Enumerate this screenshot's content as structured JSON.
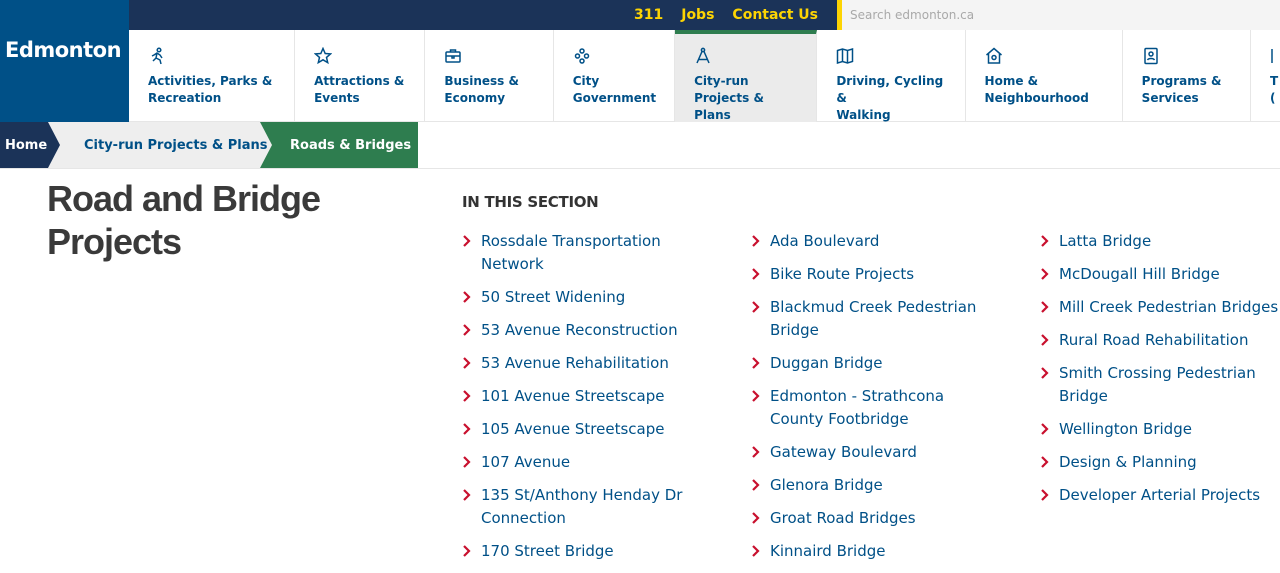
{
  "brand": {
    "logo_text": "Edmonton",
    "colors": {
      "primary_blue": "#005087",
      "navy": "#1b3358",
      "accent_yellow": "#fdd403",
      "green": "#2e7d4f",
      "chevron_red": "#c8102e"
    }
  },
  "utility": {
    "links": [
      "311",
      "Jobs",
      "Contact Us"
    ],
    "search_placeholder": "Search edmonton.ca"
  },
  "nav": {
    "items": [
      {
        "line1": "Activities, Parks &",
        "line2": "Recreation",
        "icon": "running-person-icon"
      },
      {
        "line1": "Attractions &",
        "line2": "Events",
        "icon": "star-icon"
      },
      {
        "line1": "Business &",
        "line2": "Economy",
        "icon": "briefcase-icon"
      },
      {
        "line1": "City",
        "line2": "Government",
        "icon": "people-group-icon"
      },
      {
        "line1": "City-run Projects &",
        "line2": "Plans",
        "icon": "compass-icon",
        "active": true
      },
      {
        "line1": "Driving, Cycling &",
        "line2": "Walking",
        "icon": "map-icon"
      },
      {
        "line1": "Home &",
        "line2": "Neighbourhood",
        "icon": "house-icon"
      },
      {
        "line1": "Programs &",
        "line2": "Services",
        "icon": "person-card-icon"
      },
      {
        "line1": "T",
        "line2": "(",
        "icon": "partial-icon"
      }
    ]
  },
  "breadcrumb": {
    "home": "Home",
    "parent": "City-run Projects & Plans",
    "current": "Roads & Bridges"
  },
  "page": {
    "title_line1": "Road and Bridge",
    "title_line2": "Projects",
    "section_heading": "IN THIS SECTION"
  },
  "section_links": {
    "col1": [
      "Rossdale Transportation Network",
      "50 Street Widening",
      "53 Avenue Reconstruction",
      "53 Avenue Rehabilitation",
      "101 Avenue Streetscape",
      "105 Avenue Streetscape",
      "107 Avenue",
      "135 St/Anthony Henday Dr Connection",
      "170 Street Bridge"
    ],
    "col2": [
      "Ada Boulevard",
      "Bike Route Projects",
      "Blackmud Creek Pedestrian Bridge",
      "Duggan Bridge",
      "Edmonton - Strathcona County Footbridge",
      "Gateway Boulevard",
      "Glenora Bridge",
      "Groat Road Bridges",
      "Kinnaird Bridge"
    ],
    "col3": [
      "Latta Bridge",
      "McDougall Hill Bridge",
      "Mill Creek Pedestrian Bridges",
      "Rural Road Rehabilitation",
      "Smith Crossing Pedestrian Bridge",
      "Wellington Bridge",
      "Design & Planning",
      "Developer Arterial Projects"
    ]
  }
}
